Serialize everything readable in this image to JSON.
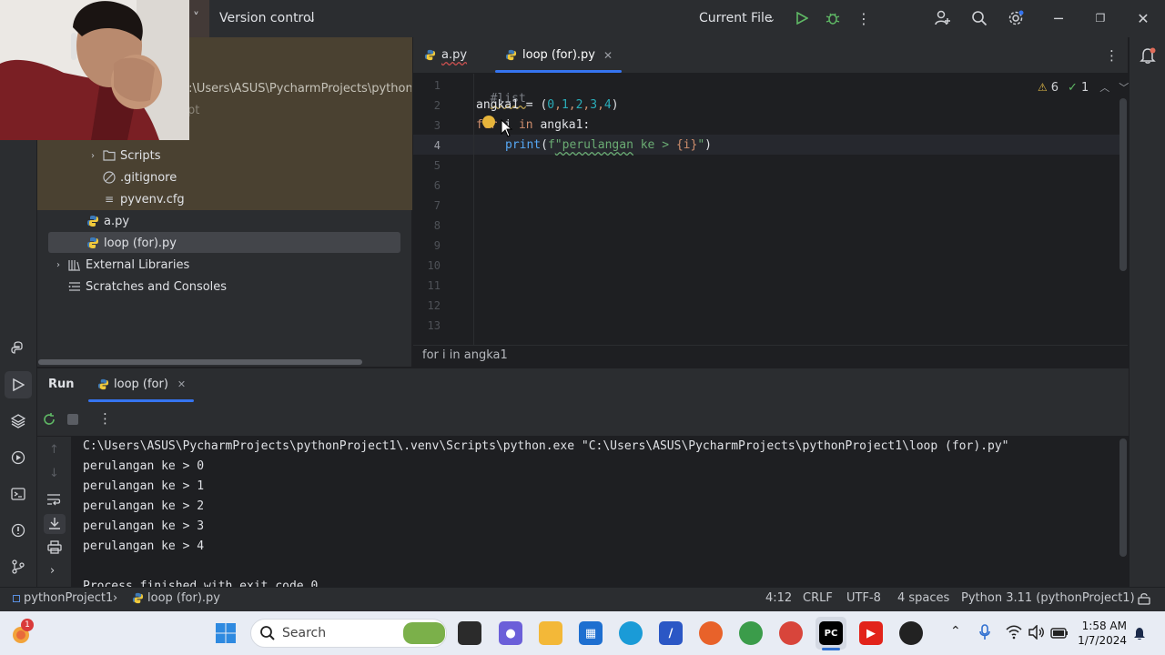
{
  "titlebar": {
    "project_menu_chevron": "˅",
    "vcs_label": "Version control",
    "run_config_label": "Current File"
  },
  "project_tree": {
    "path_fragment": "C:\\Users\\ASUS\\PycharmProjects\\pythonI",
    "hidden_fragment": "pt",
    "items": [
      {
        "label": "Scripts",
        "icon": "folder-icon"
      },
      {
        "label": ".gitignore",
        "icon": "ignore-file-icon"
      },
      {
        "label": "pyvenv.cfg",
        "icon": "config-file-icon"
      },
      {
        "label": "a.py",
        "icon": "python-file-icon"
      },
      {
        "label": "loop (for).py",
        "icon": "python-file-icon"
      },
      {
        "label": "External Libraries",
        "icon": "library-icon"
      },
      {
        "label": "Scratches and Consoles",
        "icon": "scratches-icon"
      }
    ]
  },
  "editor": {
    "tabs": [
      {
        "label": "a.py"
      },
      {
        "label": "loop (for).py"
      }
    ],
    "warnings_count": "6",
    "checks_count": "1",
    "line_numbers": [
      "1",
      "2",
      "3",
      "4",
      "5",
      "6",
      "7",
      "8",
      "9",
      "10",
      "11",
      "12",
      "13"
    ],
    "current_line": "4",
    "code": {
      "line1": "#list",
      "line2_var": "angka1",
      "line2_eq": " = (",
      "line2_nums": [
        "0",
        "1",
        "2",
        "3",
        "4"
      ],
      "line2_close": ")",
      "line3_for": "for",
      "line3_i": " i ",
      "line3_in": "in",
      "line3_rest": " angka1:",
      "line4_print": "print",
      "line4_open": "(",
      "line4_f": "f",
      "line4_str_a": "\"perulangan",
      "line4_str_b": " ke > ",
      "line4_brace": "{i}",
      "line4_str_c": "\"",
      "line4_close": ")"
    },
    "breadcrumb": "for i in angka1"
  },
  "run_panel": {
    "title": "Run",
    "tab_label": "loop (for)",
    "console_lines": [
      "C:\\Users\\ASUS\\PycharmProjects\\pythonProject1\\.venv\\Scripts\\python.exe \"C:\\Users\\ASUS\\PycharmProjects\\pythonProject1\\loop (for).py\"",
      "perulangan ke > 0",
      "perulangan ke > 1",
      "perulangan ke > 2",
      "perulangan ke > 3",
      "perulangan ke > 4",
      "",
      "Process finished with exit code 0"
    ]
  },
  "statusbar": {
    "project": "pythonProject1",
    "file": "loop (for).py",
    "position": "4:12",
    "line_sep": "CRLF",
    "encoding": "UTF-8",
    "indent": "4 spaces",
    "interpreter": "Python 3.11 (pythonProject1)"
  },
  "taskbar": {
    "search_placeholder": "Search",
    "time": "1:58 AM",
    "date": "1/7/2024",
    "widget_badge": "1",
    "pycharm_label": "PC"
  },
  "colors": {
    "accent": "#3574f0",
    "keyword": "#cf8e6d",
    "string": "#6aab73",
    "number": "#2aacb8",
    "function": "#56a8f5",
    "comment": "#7a7e85"
  }
}
